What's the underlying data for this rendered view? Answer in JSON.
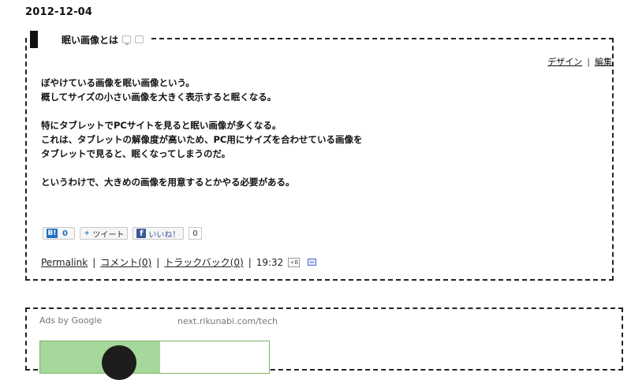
{
  "post": {
    "date": "2012-12-04",
    "title": "眠い画像とは",
    "edit_links": [
      "デザイン",
      "編集"
    ],
    "edit_separator": "|",
    "paragraphs": [
      [
        "ぼやけている画像を眠い画像という。",
        "概してサイズの小さい画像を大きく表示すると眠くなる。"
      ],
      [
        "特にタブレットでPCサイトを見ると眠い画像が多くなる。",
        "これは、タブレットの解像度が高いため、PC用にサイズを合わせている画像を",
        "タブレットで見ると、眠くなってしまうのだ。"
      ],
      [
        "というわけで、大きめの画像を用意するとかやる必要がある。"
      ]
    ],
    "social": {
      "hatena_logo": "B!",
      "hatena_count": "0",
      "tweet_label": "ツイート",
      "like_label": "いいね！",
      "like_count": "0"
    },
    "footer": {
      "permalink": "Permalink",
      "comments": "コメント(0)",
      "trackback": "トラックバック(0)",
      "time": "19:32",
      "tb_icon": "+B",
      "sep": "|"
    }
  },
  "ads": {
    "label": "Ads by Google",
    "url": "next.rikunabi.com/tech"
  },
  "colors": {
    "hatena": "#1f70c1",
    "twitter": "#4a9ee0",
    "facebook": "#3b5998"
  }
}
